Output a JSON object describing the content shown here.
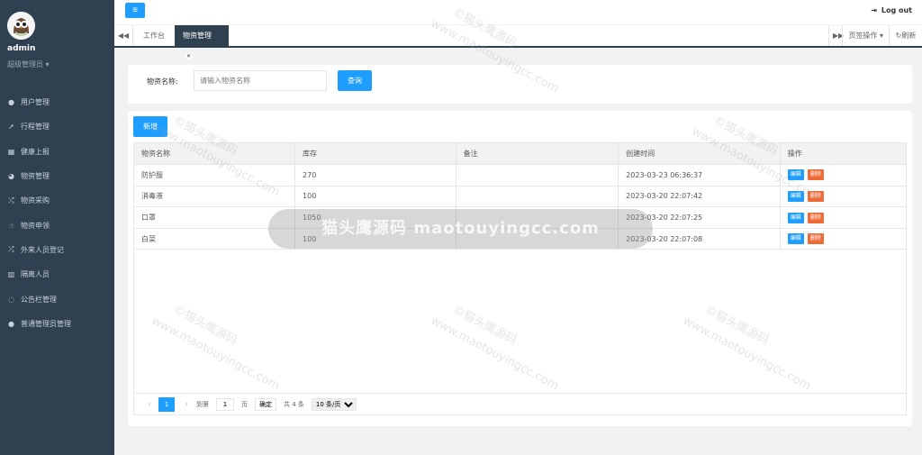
{
  "sidebar": {
    "user_name": "admin",
    "user_role": "超级管理员",
    "items": [
      {
        "label": "用户管理",
        "icon": "user-icon"
      },
      {
        "label": "行程管理",
        "icon": "paper-plane-icon"
      },
      {
        "label": "健康上报",
        "icon": "calendar-icon"
      },
      {
        "label": "物资管理",
        "icon": "dashboard-icon"
      },
      {
        "label": "物资采购",
        "icon": "random-icon"
      },
      {
        "label": "物资申领",
        "icon": "hand-icon"
      },
      {
        "label": "外来人员登记",
        "icon": "random-icon"
      },
      {
        "label": "隔离人员",
        "icon": "building-icon"
      },
      {
        "label": "公告栏管理",
        "icon": "comment-icon"
      },
      {
        "label": "普通管理员管理",
        "icon": "user-icon"
      }
    ]
  },
  "topbar": {
    "logout_label": "Log out"
  },
  "tabs": {
    "home_label": "工作台",
    "active_label": "物资管理",
    "ops_label": "页签操作",
    "refresh_label": "刷新"
  },
  "search": {
    "label": "物资名称:",
    "placeholder": "请输入物资名称",
    "button_label": "查询"
  },
  "table": {
    "add_label": "新增",
    "columns": [
      "物资名称",
      "库存",
      "备注",
      "创建时间",
      "操作"
    ],
    "rows": [
      {
        "name": "防护服",
        "stock": "270",
        "note": "",
        "created": "2023-03-23 06:36:37"
      },
      {
        "name": "消毒液",
        "stock": "100",
        "note": "",
        "created": "2023-03-20 22:07:42"
      },
      {
        "name": "口罩",
        "stock": "1050",
        "note": "",
        "created": "2023-03-20 22:07:25"
      },
      {
        "name": "白菜",
        "stock": "100",
        "note": "",
        "created": "2023-03-20 22:07:08"
      }
    ],
    "edit_label": "编辑",
    "delete_label": "删除"
  },
  "pager": {
    "current_page": "1",
    "goto_label": "到第",
    "goto_value": "1",
    "page_unit": "页",
    "confirm_label": "确定",
    "total_label": "共 4 条",
    "page_size": "10 条/页"
  },
  "watermark": {
    "pill_text": "猫头鹰源码 maotouyingcc.com",
    "diagonal_text_cn": "©猫头鹰源码",
    "diagonal_text_en": "www.maotouyingcc.com"
  },
  "colors": {
    "sidebar_bg": "#2f4050",
    "primary": "#1e9fff",
    "danger": "#ee6a37"
  }
}
